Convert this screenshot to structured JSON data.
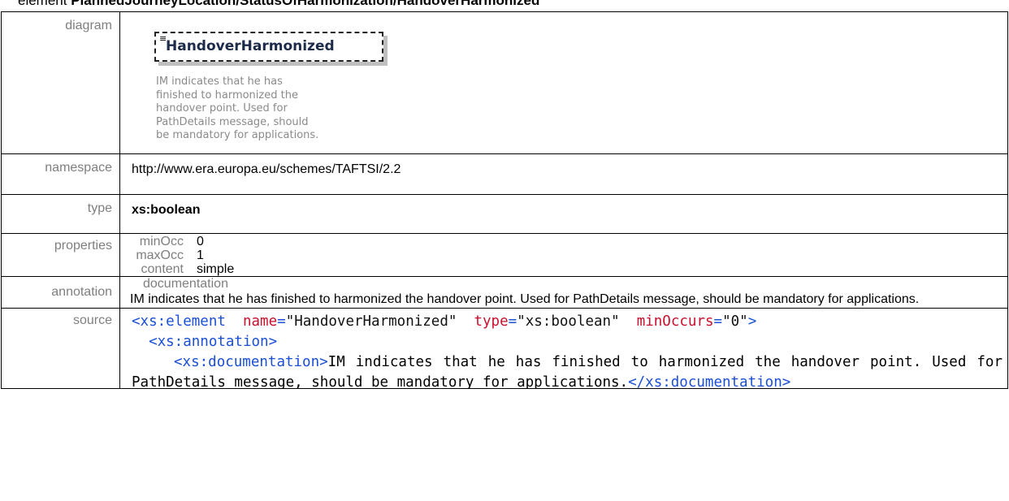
{
  "heading": {
    "prefix": "element ",
    "path": "PlannedJourneyLocation/StatusOfHarmonization/HandoverHarmonized"
  },
  "rows": {
    "diagram": {
      "label": "diagram",
      "element_name": "HandoverHarmonized",
      "doc_lines": [
        "IM indicates that he has",
        "finished to harmonized the",
        "handover point. Used for",
        "PathDetails message, should",
        "be mandatory for applications."
      ]
    },
    "namespace": {
      "label": "namespace",
      "value": "http://www.era.europa.eu/schemes/TAFTSI/2.2"
    },
    "type": {
      "label": "type",
      "value": "xs:boolean"
    },
    "properties": {
      "label": "properties",
      "items": [
        {
          "key": "minOcc",
          "value": "0"
        },
        {
          "key": "maxOcc",
          "value": "1"
        },
        {
          "key": "content",
          "value": "simple"
        }
      ]
    },
    "annotation": {
      "label": "annotation",
      "title": "documentation",
      "text": "IM indicates that he has finished to harmonized the handover point. Used for PathDetails message, should be mandatory for applications."
    },
    "source": {
      "label": "source",
      "open_tag": "<xs:element",
      "attrs": [
        {
          "name": "name",
          "eq": "=",
          "value": "\"HandoverHarmonized\""
        },
        {
          "name": "type",
          "eq": "=",
          "value": "\"xs:boolean\""
        },
        {
          "name": "minOccurs",
          "eq": "=",
          "value": "\"0\""
        }
      ],
      "open_end": ">",
      "annotation_tag": "<xs:annotation>",
      "documentation_open": "<xs:documentation>",
      "documentation_text": "IM indicates that he has finished to harmonized the handover point. Used for PathDetails message, should be mandatory for applications.",
      "documentation_close": "</xs:documentation>"
    }
  }
}
